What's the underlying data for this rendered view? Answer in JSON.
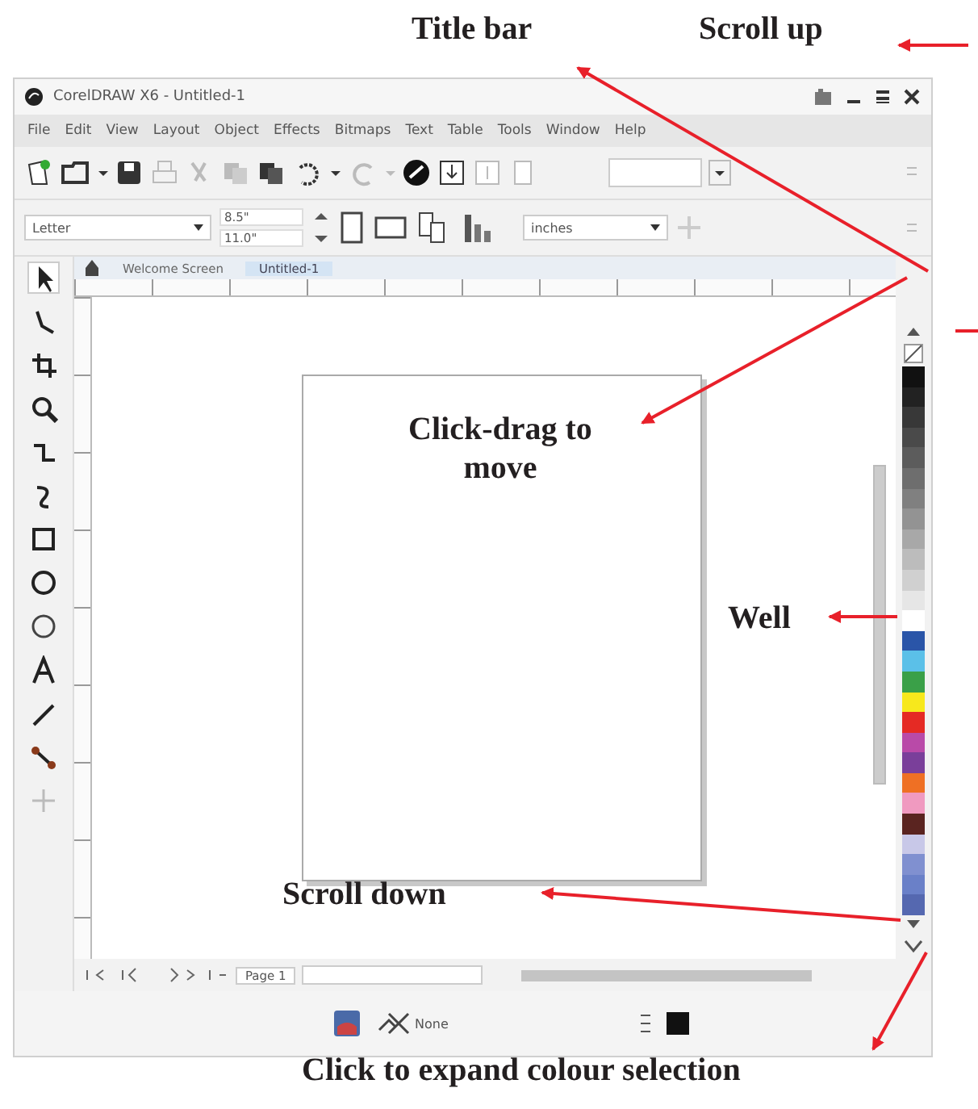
{
  "window": {
    "title": "CorelDRAW X6 - Untitled-1"
  },
  "menu": [
    "File",
    "Edit",
    "View",
    "Layout",
    "Object",
    "Effects",
    "Bitmaps",
    "Text",
    "Table",
    "Tools",
    "Window",
    "Help"
  ],
  "property_bar": {
    "paper": "Letter",
    "width": "8.5\"",
    "height": "11.0\"",
    "units": "inches"
  },
  "doc_tabs": [
    {
      "label": "Welcome Screen",
      "selected": false
    },
    {
      "label": "Untitled-1",
      "selected": true
    }
  ],
  "palette": [
    {
      "color": "#111111"
    },
    {
      "color": "#222222"
    },
    {
      "color": "#383838"
    },
    {
      "color": "#4a4a4a"
    },
    {
      "color": "#5c5c5c"
    },
    {
      "color": "#6e6e6e"
    },
    {
      "color": "#808080"
    },
    {
      "color": "#939393"
    },
    {
      "color": "#a8a8a8"
    },
    {
      "color": "#bcbcbc"
    },
    {
      "color": "#d0d0d0"
    },
    {
      "color": "#e6e6e6"
    },
    {
      "color": "#ffffff"
    },
    {
      "color": "#2a55a8"
    },
    {
      "color": "#5bc0e8"
    },
    {
      "color": "#3aa048"
    },
    {
      "color": "#f7e81c"
    },
    {
      "color": "#e52a24"
    },
    {
      "color": "#b94aa8"
    },
    {
      "color": "#7a3f9a"
    },
    {
      "color": "#ef7024"
    },
    {
      "color": "#f09ac0"
    },
    {
      "color": "#5a2420"
    },
    {
      "color": "#c8c8e8"
    },
    {
      "color": "#8090d0"
    },
    {
      "color": "#6a80c8"
    },
    {
      "color": "#5568b0"
    }
  ],
  "page_nav": {
    "page_tab": "Page 1"
  },
  "status_bar": {
    "fill": "None"
  },
  "annotations": [
    {
      "kind": "title_bar",
      "text": "Title bar"
    },
    {
      "kind": "scroll_up",
      "text": "Scroll up"
    },
    {
      "kind": "move",
      "text": "Click-drag to move"
    },
    {
      "kind": "well",
      "text": "Well"
    },
    {
      "kind": "scroll_down",
      "text": "Scroll down"
    },
    {
      "kind": "expand",
      "text": "Click to expand colour selection"
    }
  ]
}
